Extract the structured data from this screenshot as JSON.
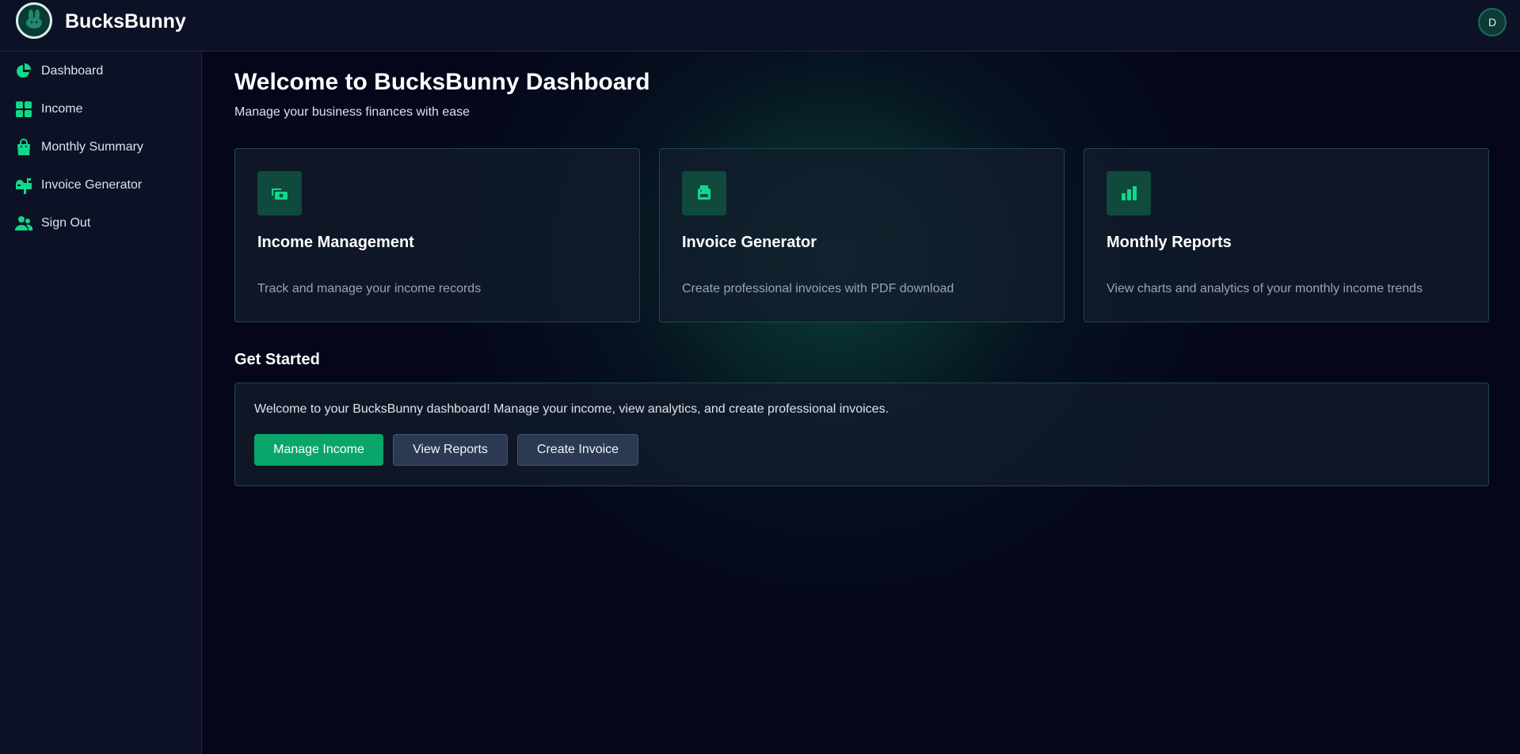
{
  "header": {
    "brand": "BucksBunny",
    "avatar_initial": "D"
  },
  "sidebar": {
    "items": [
      {
        "label": "Dashboard",
        "icon": "pie-chart-icon"
      },
      {
        "label": "Income",
        "icon": "grid-icon"
      },
      {
        "label": "Monthly Summary",
        "icon": "shopping-bag-icon"
      },
      {
        "label": "Invoice Generator",
        "icon": "mailbox-icon"
      },
      {
        "label": "Sign Out",
        "icon": "users-icon"
      }
    ]
  },
  "main": {
    "title": "Welcome to BucksBunny Dashboard",
    "subtitle": "Manage your business finances with ease",
    "cards": [
      {
        "title": "Income Management",
        "description": "Track and manage your income records",
        "icon": "cash-icon"
      },
      {
        "title": "Invoice Generator",
        "description": "Create professional invoices with PDF download",
        "icon": "printer-icon"
      },
      {
        "title": "Monthly Reports",
        "description": "View charts and analytics of your monthly income trends",
        "icon": "bar-chart-icon"
      }
    ],
    "get_started": {
      "title": "Get Started",
      "text": "Welcome to your BucksBunny dashboard! Manage your income, view analytics, and create professional invoices.",
      "buttons": {
        "manage_income": "Manage Income",
        "view_reports": "View Reports",
        "create_invoice": "Create Invoice"
      }
    }
  },
  "colors": {
    "accent": "#10d98a",
    "primary_button": "#0aa56b",
    "background": "#05061a",
    "sidebar": "#0d1126"
  }
}
